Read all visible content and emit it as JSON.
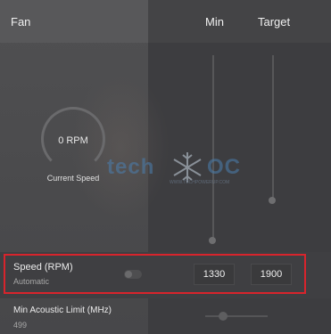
{
  "header": {
    "section_title": "Fan",
    "col_min": "Min",
    "col_target": "Target"
  },
  "gauge": {
    "value": "0 RPM",
    "label": "Current Speed"
  },
  "watermark": {
    "text_left": "tech",
    "text_right": "OC",
    "subtext": "WWW.TECHPOWERUP.COM"
  },
  "speed_row": {
    "label": "Speed (RPM)",
    "sublabel": "Automatic",
    "min_value": "1330",
    "target_value": "1900",
    "toggle_on": false
  },
  "acoustic_row": {
    "label": "Min Acoustic Limit (MHz)",
    "value": "499"
  },
  "colors": {
    "highlight": "#d8242c",
    "watermark": "#4b7fb0"
  }
}
